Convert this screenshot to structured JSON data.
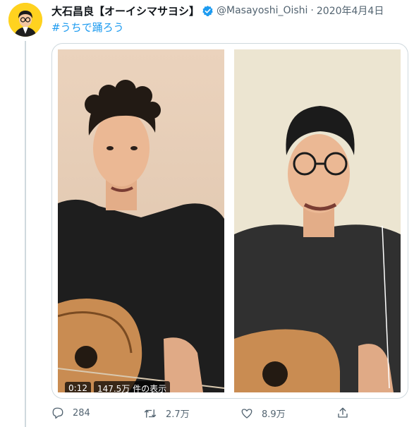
{
  "tweet": {
    "display_name": "大石昌良【オーイシマサヨシ】",
    "handle": "@Masayoshi_Oishi",
    "separator": "·",
    "date": "2020年4月4日",
    "hashtag": "#うちで踊ろう"
  },
  "video": {
    "time": "0:12",
    "views": "147.5万 件の表示"
  },
  "actions": {
    "replies": "284",
    "retweets": "2.7万",
    "likes": "8.9万"
  },
  "colors": {
    "link": "#1d9bf0",
    "muted": "#536471",
    "verified": "#1d9bf0"
  }
}
